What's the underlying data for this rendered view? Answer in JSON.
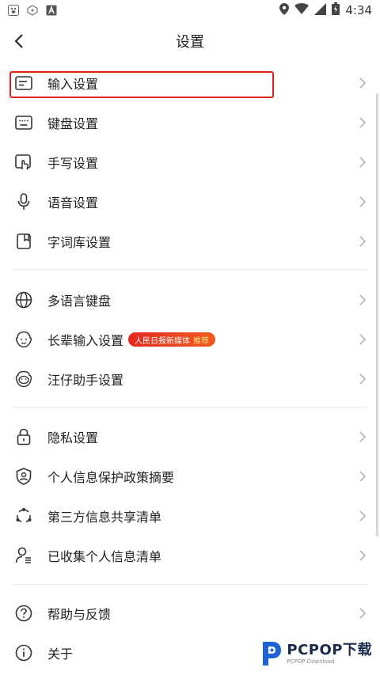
{
  "status_bar": {
    "time": "4:34"
  },
  "header": {
    "title": "设置"
  },
  "sections": [
    {
      "items": [
        {
          "label": "输入设置",
          "icon": "input-settings-icon"
        },
        {
          "label": "键盘设置",
          "icon": "keyboard-icon"
        },
        {
          "label": "手写设置",
          "icon": "handwriting-icon"
        },
        {
          "label": "语音设置",
          "icon": "microphone-icon"
        },
        {
          "label": "字词库设置",
          "icon": "dictionary-icon"
        }
      ]
    },
    {
      "items": [
        {
          "label": "多语言键盘",
          "icon": "globe-icon"
        },
        {
          "label": "长辈输入设置",
          "icon": "elder-face-icon",
          "badge": "人民日报新媒体",
          "badge_tag": "推荐"
        },
        {
          "label": "汪仔助手设置",
          "icon": "assistant-dog-icon"
        }
      ]
    },
    {
      "items": [
        {
          "label": "隐私设置",
          "icon": "lock-icon"
        },
        {
          "label": "个人信息保护政策摘要",
          "icon": "shield-person-icon"
        },
        {
          "label": "第三方信息共享清单",
          "icon": "share-nodes-icon"
        },
        {
          "label": "已收集个人信息清单",
          "icon": "person-list-icon"
        }
      ]
    },
    {
      "items": [
        {
          "label": "帮助与反馈",
          "icon": "help-icon"
        },
        {
          "label": "关于",
          "icon": "info-icon"
        }
      ]
    }
  ],
  "watermark": {
    "main": "PCPOP下载",
    "sub": "PCPOP Download"
  },
  "colors": {
    "highlight": "#e0201c",
    "badge": "#e42a1e"
  }
}
